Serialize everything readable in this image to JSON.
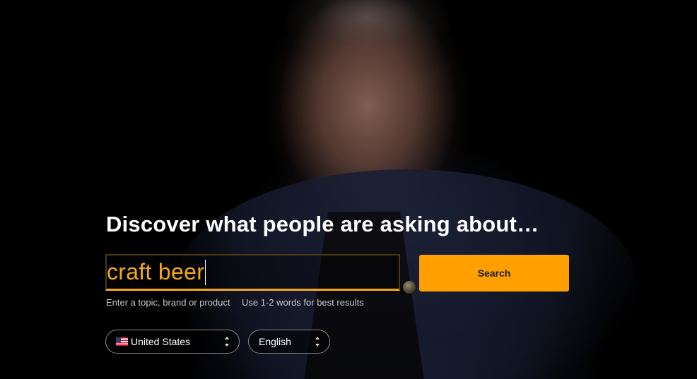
{
  "hero": {
    "headline": "Discover what people are asking about…"
  },
  "search": {
    "value": "craft beer",
    "button_label": "Search",
    "hint_primary": "Enter a topic, brand or product",
    "hint_secondary": "Use 1-2 words for best results"
  },
  "filters": {
    "country": {
      "selected": "United States",
      "flag_icon": "us-flag-icon"
    },
    "language": {
      "selected": "English"
    }
  },
  "colors": {
    "accent": "#ffa000",
    "input_text": "#f3a81c",
    "headline": "#ffffff",
    "hint_text": "#c8c8c8"
  }
}
